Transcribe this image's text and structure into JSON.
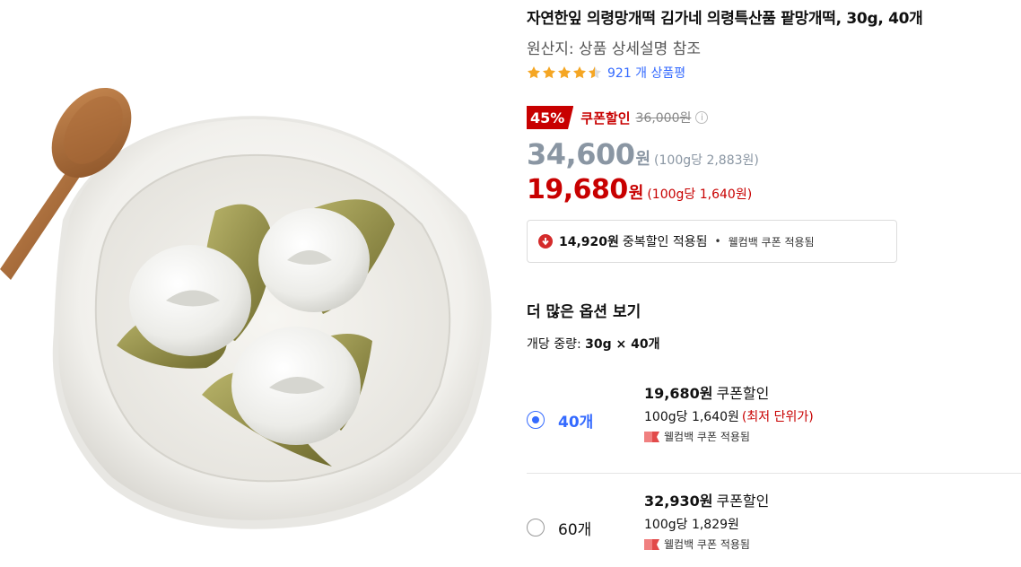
{
  "product": {
    "title": "자연한잎 의령망개떡 김가네 의령특산품 팥망개떡, 30g, 40개",
    "origin": "원산지: 상품 상세설명 참조",
    "rating_stars": 4.5,
    "review_text": "921 개 상품평"
  },
  "pricing": {
    "discount_badge": "45%",
    "coupon_label": "쿠폰할인",
    "original_price": "36,000원",
    "sale_price": "34,600",
    "sale_won": "원",
    "sale_unit": "(100g당 2,883원)",
    "coupon_price": "19,680",
    "coupon_won": "원",
    "coupon_unit": "(100g당 1,640원)"
  },
  "benefit": {
    "amount": "14,920원",
    "label": "중복할인 적용됨",
    "dot": "•",
    "welcome": "웰컴백 쿠폰 적용됨"
  },
  "options": {
    "header": "더 많은 옵션 보기",
    "unit_weight_label": "개당 중량: ",
    "unit_weight_value": "30g × 40개",
    "items": [
      {
        "qty": "40개",
        "selected": true,
        "price": "19,680원",
        "coupon_label": "쿠폰할인",
        "unit_price": "100g당 1,640원",
        "lowest_label": "(최저 단위가)",
        "welcome": "웰컴백 쿠폰 적용됨"
      },
      {
        "qty": "60개",
        "selected": false,
        "price": "32,930원",
        "coupon_label": "쿠폰할인",
        "unit_price": "100g당 1,829원",
        "lowest_label": "",
        "welcome": "웰컴백 쿠폰 적용됨"
      }
    ]
  },
  "colors": {
    "accent_red": "#c80000",
    "link_blue": "#346aff",
    "muted_gray": "#8a96a3",
    "star_orange": "#f5a623"
  },
  "icons": {
    "star": "star-icon",
    "info": "info-icon",
    "down_arrow": "down-arrow-icon",
    "welcome_coupon": "coupon-flag-icon"
  }
}
